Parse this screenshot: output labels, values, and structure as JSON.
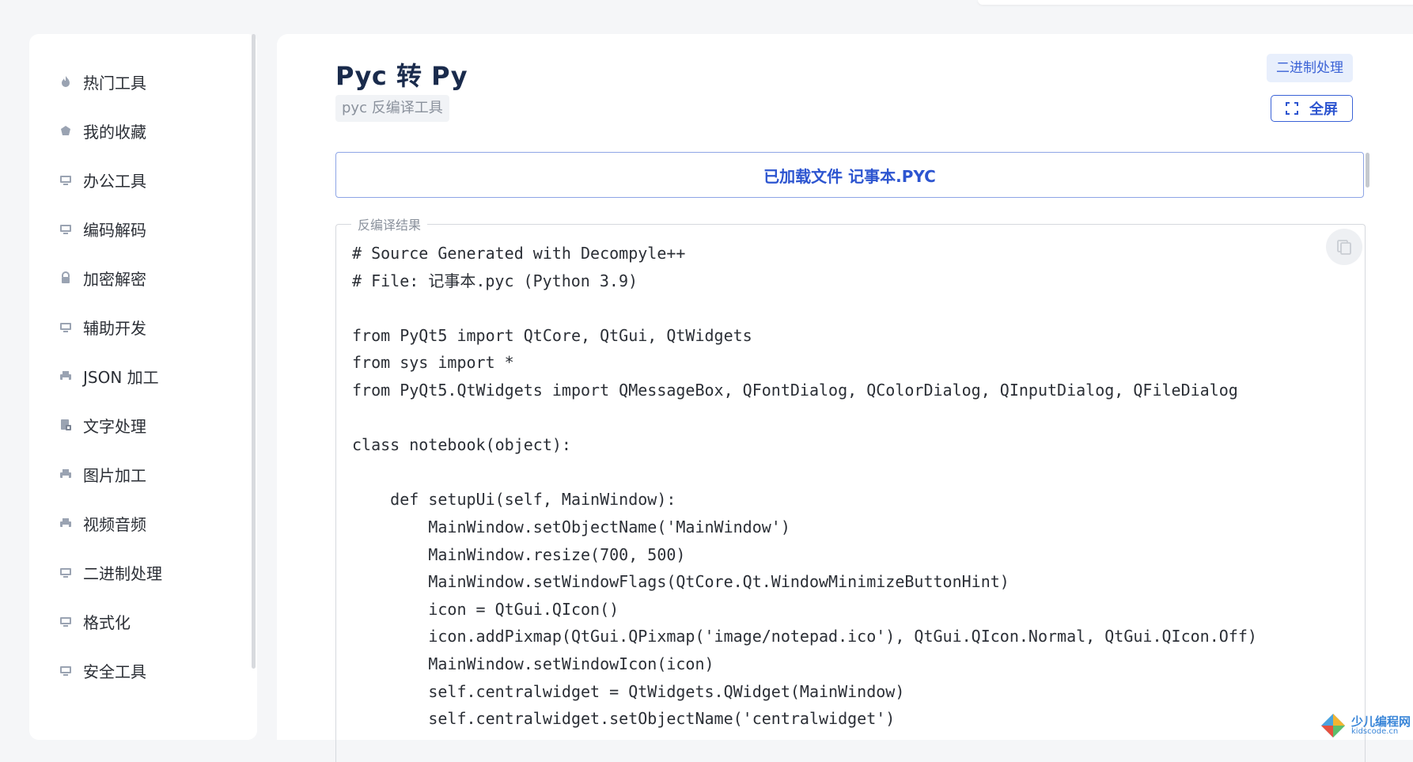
{
  "sidebar": {
    "items": [
      {
        "label": "热门工具",
        "icon": "fire-icon"
      },
      {
        "label": "我的收藏",
        "icon": "collection-icon"
      },
      {
        "label": "办公工具",
        "icon": "monitor-icon"
      },
      {
        "label": "编码解码",
        "icon": "monitor-icon"
      },
      {
        "label": "加密解密",
        "icon": "lock-icon"
      },
      {
        "label": "辅助开发",
        "icon": "monitor-icon"
      },
      {
        "label": "JSON 加工",
        "icon": "printer-icon"
      },
      {
        "label": "文字处理",
        "icon": "document-lock-icon"
      },
      {
        "label": "图片加工",
        "icon": "printer-icon"
      },
      {
        "label": "视频音频",
        "icon": "printer-icon"
      },
      {
        "label": "二进制处理",
        "icon": "monitor-icon"
      },
      {
        "label": "格式化",
        "icon": "monitor-icon"
      },
      {
        "label": "安全工具",
        "icon": "monitor-icon"
      }
    ]
  },
  "main": {
    "title": "Pyc 转 Py",
    "subtitle": "pyc 反编译工具",
    "category_badge": "二进制处理",
    "fullscreen_label": "全屏",
    "loaded_file_text": "已加载文件 记事本.PYC",
    "result_legend": "反编译结果",
    "code_lines": [
      "# Source Generated with Decompyle++",
      "# File: 记事本.pyc (Python 3.9)",
      "",
      "from PyQt5 import QtCore, QtGui, QtWidgets",
      "from sys import *",
      "from PyQt5.QtWidgets import QMessageBox, QFontDialog, QColorDialog, QInputDialog, QFileDialog",
      "",
      "class notebook(object):",
      "",
      "    def setupUi(self, MainWindow):",
      "        MainWindow.setObjectName('MainWindow')",
      "        MainWindow.resize(700, 500)",
      "        MainWindow.setWindowFlags(QtCore.Qt.WindowMinimizeButtonHint)",
      "        icon = QtGui.QIcon()",
      "        icon.addPixmap(QtGui.QPixmap('image/notepad.ico'), QtGui.QIcon.Normal, QtGui.QIcon.Off)",
      "        MainWindow.setWindowIcon(icon)",
      "        self.centralwidget = QtWidgets.QWidget(MainWindow)",
      "        self.centralwidget.setObjectName('centralwidget')"
    ]
  },
  "watermark": {
    "cn": "少儿编程网",
    "en": "kidscode.cn"
  },
  "colors": {
    "accent": "#2d55d0",
    "title": "#1a2b4c",
    "muted": "#8a919c"
  }
}
